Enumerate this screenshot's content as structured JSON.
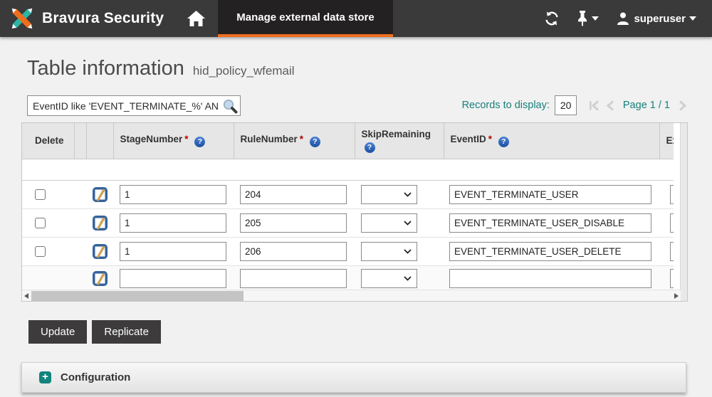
{
  "colors": {
    "orange": "#ee6e1e",
    "teal": "#17807c",
    "nav_bg": "#3b3a3a",
    "tab_bg": "#242122",
    "help_blue": "#2c60b4"
  },
  "header": {
    "brand": "Bravura Security",
    "active_tab": "Manage external data store",
    "user": "superuser"
  },
  "page": {
    "title": "Table information",
    "subtitle": "hid_policy_wfemail"
  },
  "toolbar": {
    "filter_value": "EventID like 'EVENT_TERMINATE_%' AN",
    "records_label": "Records to display:",
    "records_value": "20",
    "page_indicator": "Page 1 / 1"
  },
  "table": {
    "required_marker": "*",
    "help_glyph": "?",
    "columns": {
      "delete": "Delete",
      "stage": "StageNumber",
      "rule": "RuleNumber",
      "skip": "SkipRemaining",
      "event": "EventID",
      "expr": "Expr"
    },
    "rows": [
      {
        "stage": "1",
        "rule": "204",
        "event": "EVENT_TERMINATE_USER",
        "expr": ""
      },
      {
        "stage": "1",
        "rule": "205",
        "event": "EVENT_TERMINATE_USER_DISABLE",
        "expr": ""
      },
      {
        "stage": "1",
        "rule": "206",
        "event": "EVENT_TERMINATE_USER_DELETE",
        "expr": ""
      }
    ],
    "new_row": {
      "stage": "",
      "rule": "",
      "event": "",
      "expr": ""
    }
  },
  "actions": {
    "update": "Update",
    "replicate": "Replicate"
  },
  "sections": {
    "configuration_label": "Configuration",
    "expand_glyph": "+"
  }
}
